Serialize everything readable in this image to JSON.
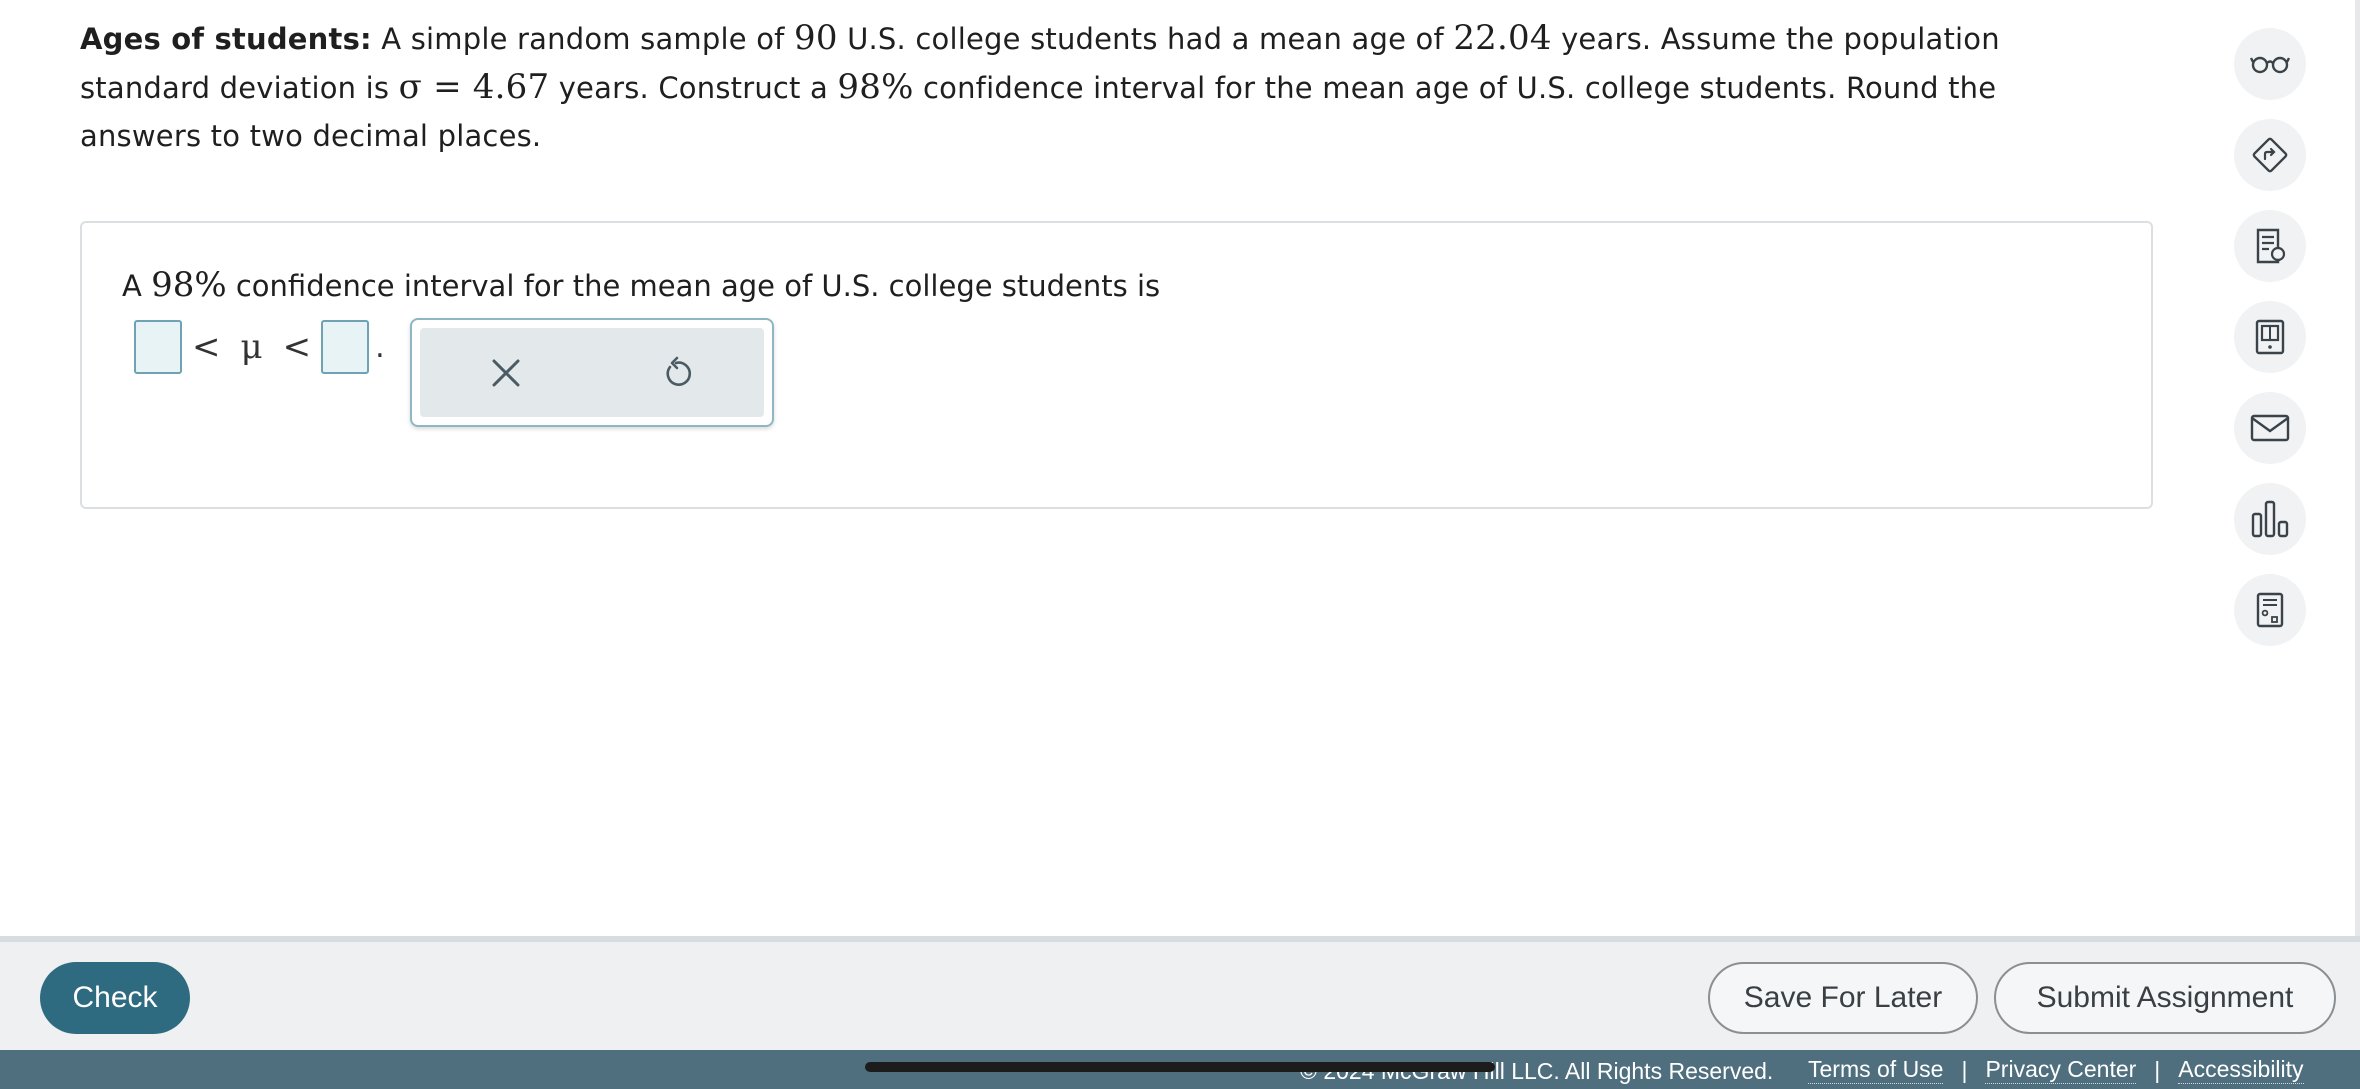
{
  "question": {
    "title": "Ages of students:",
    "t1": " A simple random sample of ",
    "n": "90",
    "t2": " U.S. college students had a mean age of ",
    "mean": "22.04",
    "t3": " years. Assume the population standard deviation is ",
    "sigma": "σ = 4.67",
    "t4": " years. Construct a ",
    "conf": "98%",
    "t5": " confidence interval for the mean age of U.S. college students. Round the answers to two decimal places."
  },
  "answer": {
    "prefix": "A ",
    "conf": "98%",
    "suffix": " confidence interval for the mean age of U.S. college students is",
    "lower_value": "",
    "lt1": "<",
    "mu": "μ",
    "lt2": "<",
    "upper_value": "",
    "period": "."
  },
  "popup": {
    "clear_icon": "close-icon",
    "undo_icon": "undo-icon"
  },
  "sidebar": {
    "items": [
      {
        "icon": "glasses-icon"
      },
      {
        "icon": "directions-icon"
      },
      {
        "icon": "hint-doc-icon"
      },
      {
        "icon": "ebook-icon"
      },
      {
        "icon": "mail-icon"
      },
      {
        "icon": "bar-chart-icon"
      },
      {
        "icon": "calculator-icon"
      }
    ]
  },
  "actions": {
    "check_label": "Check",
    "save_label": "Save For Later",
    "submit_label": "Submit Assignment"
  },
  "footer": {
    "copyright": "© 2024 McGraw Hill LLC. All Rights Reserved.",
    "links": [
      "Terms of Use",
      "Privacy Center",
      "Accessibility"
    ],
    "separator": "|"
  },
  "colors": {
    "primary": "#2f6b80",
    "footer_strip": "#4f6f7e",
    "input_fill": "#e8f3f6",
    "input_border": "#6fa2b3"
  }
}
